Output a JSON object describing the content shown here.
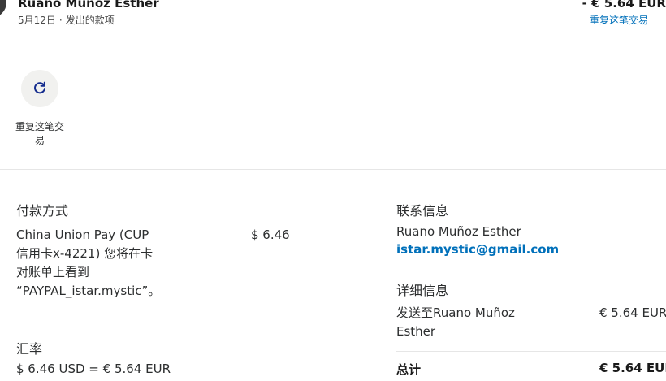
{
  "header": {
    "name": "Ruano Munoz Esther",
    "date": "5月12日",
    "separator": "·",
    "type": "发出的款项",
    "amount": "- € 5.64 EUR",
    "repeat_link": "重复这笔交易"
  },
  "action": {
    "icon": "refresh-icon",
    "label": "重复这笔交易"
  },
  "payment": {
    "title": "付款方式",
    "description": "China Union Pay (CUP信用卡x-4221) 您将在卡对账单上看到 “PAYPAL_istar.mystic”。",
    "amount": "$ 6.46"
  },
  "exchange": {
    "title": "汇率",
    "value": "$ 6.46 USD = € 5.64 EUR"
  },
  "contact": {
    "title": "联系信息",
    "name": "Ruano Muñoz Esther",
    "email": "istar.mystic@gmail.com"
  },
  "details": {
    "title": "详细信息",
    "send_to_label": "发送至Ruano Muñoz Esther",
    "send_to_amount": "€ 5.64 EUR",
    "total_label": "总计",
    "total_amount": "€ 5.64 EUR"
  },
  "colors": {
    "link": "#0070ba",
    "icon": "#142c8e",
    "icon_bg": "#f1f1ef"
  }
}
